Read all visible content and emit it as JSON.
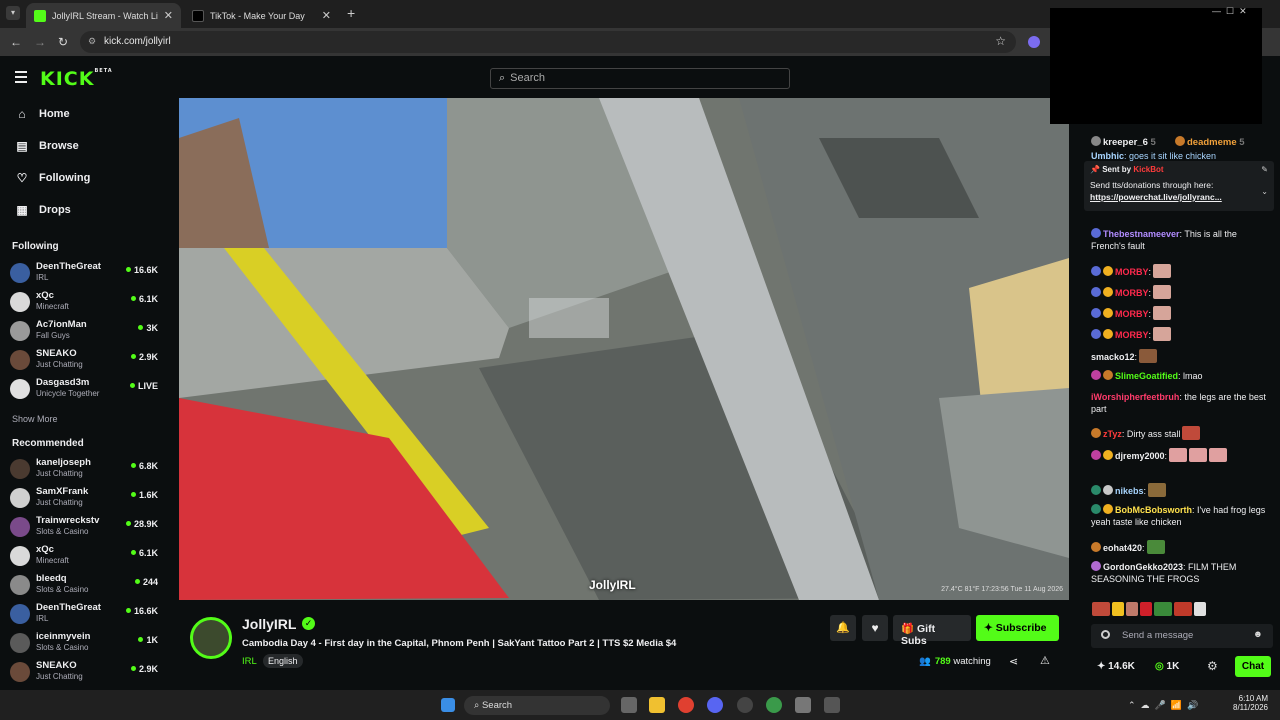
{
  "browser": {
    "tabs": [
      {
        "title": "JollyIRL Stream - Watch Live",
        "active": true
      },
      {
        "title": "TikTok - Make Your Day",
        "active": false
      }
    ],
    "url": "kick.com/jollyirl"
  },
  "header": {
    "logo": "KICK",
    "logo_badge": "BETA",
    "search_placeholder": "Search"
  },
  "sidebar": {
    "nav": [
      {
        "label": "Home",
        "icon": "home-icon"
      },
      {
        "label": "Browse",
        "icon": "browse-icon"
      },
      {
        "label": "Following",
        "icon": "heart-icon"
      },
      {
        "label": "Drops",
        "icon": "drops-icon"
      }
    ],
    "following_title": "Following",
    "following": [
      {
        "name": "DeenTheGreat",
        "category": "IRL",
        "viewers": "16.6K"
      },
      {
        "name": "xQc",
        "category": "Minecraft",
        "viewers": "6.1K"
      },
      {
        "name": "Ac7ionMan",
        "category": "Fall Guys",
        "viewers": "3K"
      },
      {
        "name": "SNEAKO",
        "category": "Just Chatting",
        "viewers": "2.9K"
      },
      {
        "name": "Dasgasd3m",
        "category": "Unicycle Together",
        "viewers": "LIVE"
      }
    ],
    "show_more": "Show More",
    "recommended_title": "Recommended",
    "recommended": [
      {
        "name": "kaneljoseph",
        "category": "Just Chatting",
        "viewers": "6.8K"
      },
      {
        "name": "SamXFrank",
        "category": "Just Chatting",
        "viewers": "1.6K"
      },
      {
        "name": "Trainwreckstv",
        "category": "Slots & Casino",
        "viewers": "28.9K"
      },
      {
        "name": "xQc",
        "category": "Minecraft",
        "viewers": "6.1K"
      },
      {
        "name": "bleedq",
        "category": "Slots & Casino",
        "viewers": "244"
      },
      {
        "name": "DeenTheGreat",
        "category": "IRL",
        "viewers": "16.6K"
      },
      {
        "name": "iceinmyvein",
        "category": "Slots & Casino",
        "viewers": "1K"
      },
      {
        "name": "SNEAKO",
        "category": "Just Chatting",
        "viewers": "2.9K"
      }
    ]
  },
  "video": {
    "watermark": "JollyIRL",
    "overlay": "27.4°C  81°F  17:23:56  Tue 11 Aug 2026"
  },
  "stream": {
    "channel": "JollyIRL",
    "title": "Cambodia Day 4 - First day in the Capital, Phnom Penh | SakYant Tattoo Part 2 | TTS $2 Media $4",
    "category": "IRL",
    "language": "English",
    "watching_count": "789",
    "watching_label": "watching",
    "gift_label": "Gift Subs",
    "subscribe_label": "Subscribe"
  },
  "chat": {
    "top_gifters": [
      {
        "rank": "2",
        "name": "kreeper_6",
        "count": "5"
      },
      {
        "rank": "",
        "name": "deadmeme",
        "count": "5"
      }
    ],
    "pinned": {
      "sent_by_label": "Sent by",
      "sender": "KickBot",
      "text": "Send tts/donations through here:",
      "link": "https://powerchat.live/jollyranc..."
    },
    "messages": [
      {
        "user": "Umbhic",
        "text": ": goes it sit like chicken",
        "color": "#a8d5ff"
      },
      {
        "user": "Thebestnameever",
        "text": ": This is all the French's fault",
        "color": "#b18cff"
      },
      {
        "user": "MORBY",
        "text": ":",
        "color": "#ff2a4d"
      },
      {
        "user": "MORBY",
        "text": ":",
        "color": "#ff2a4d"
      },
      {
        "user": "MORBY",
        "text": ":",
        "color": "#ff2a4d"
      },
      {
        "user": "MORBY",
        "text": ":",
        "color": "#ff2a4d"
      },
      {
        "user": "smacko12",
        "text": ":",
        "color": "#efeff1"
      },
      {
        "user": "SlimeGoatified",
        "text": ": lmao",
        "color": "#53fc18"
      },
      {
        "user": "iWorshipherfeetbruh",
        "text": ": the legs are the best part",
        "color": "#ff3b6b"
      },
      {
        "user": "zTyz",
        "text": ": Dirty ass stall",
        "color": "#ff3b3b"
      },
      {
        "user": "djremy2000",
        "text": ":",
        "color": "#efeff1"
      },
      {
        "user": "nikebs",
        "text": ":",
        "color": "#a8d5ff"
      },
      {
        "user": "BobMcBobsworth",
        "text": ": I've had frog legs yeah taste like chicken",
        "color": "#ffe14d"
      },
      {
        "user": "eohat420",
        "text": ":",
        "color": "#efeff1"
      },
      {
        "user": "GordonGekko2023",
        "text": ": FILM THEM SEASONING THE FROGS",
        "color": "#efeff1"
      }
    ],
    "input_placeholder": "Send a message",
    "stat_a": "14.6K",
    "stat_b": "1K",
    "chat_button": "Chat"
  },
  "taskbar": {
    "search_label": "Search",
    "time": "6:10 AM",
    "date": "8/11/2026"
  },
  "colors": {
    "kick_green": "#53fc18",
    "page_bg": "#0b0e0f"
  }
}
